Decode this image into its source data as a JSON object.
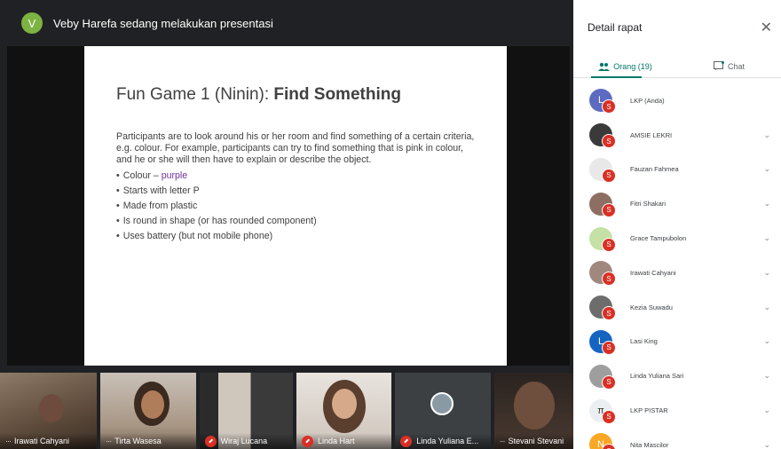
{
  "presenter": {
    "avatar_letter": "V",
    "text": "Veby Harefa sedang melakukan presentasi"
  },
  "slide": {
    "title_plain": "Fun Game 1 (Ninin): ",
    "title_bold": "Find Something",
    "body": "Participants are to look around his or her room and find something of a certain criteria, e.g. colour. For example, participants can try to find something that is pink in colour, and he or she will then have to explain or describe the object.",
    "bullet_1_prefix": "Colour – ",
    "bullet_1_colored": "purple",
    "bullets": [
      "Starts with letter P",
      "Made from plastic",
      "Is round in shape (or has rounded component)",
      "Uses battery (but not mobile phone)"
    ],
    "bullet_glyph": "•"
  },
  "thumbnails": [
    {
      "label": "Irawati Cahyani",
      "status": "more"
    },
    {
      "label": "Tirta Wasesa",
      "status": "more"
    },
    {
      "label": "Wiraj Lucana",
      "status": "muted"
    },
    {
      "label": "Linda Hart",
      "status": "muted"
    },
    {
      "label": "Linda Yuliana E...",
      "status": "muted"
    },
    {
      "label": "Stevani Stevani",
      "status": "more"
    }
  ],
  "panel": {
    "title": "Detail rapat",
    "close_glyph": "✕",
    "tabs": {
      "people": "Orang (19)",
      "chat": "Chat"
    },
    "mute_badge": "S",
    "chevron": "⌄",
    "people": [
      {
        "name": "LKP (Anda)",
        "avatar_color": "#5c6bc0",
        "letter": "L"
      },
      {
        "name": "AMSIE LEKRI",
        "avatar_color": "#3a3a3a",
        "letter": ""
      },
      {
        "name": "Fauzan Fahmea",
        "avatar_color": "#e8e8e8",
        "letter": ""
      },
      {
        "name": "Fitri Shakari",
        "avatar_color": "#8d6e63",
        "letter": ""
      },
      {
        "name": "Grace Tampubolon",
        "avatar_color": "#c5e1a5",
        "letter": ""
      },
      {
        "name": "Irawati Cahyani",
        "avatar_color": "#a1887f",
        "letter": ""
      },
      {
        "name": "Kezia Suwadu",
        "avatar_color": "#6d6d6d",
        "letter": ""
      },
      {
        "name": "Lasi King",
        "avatar_color": "#1565c0",
        "letter": "L"
      },
      {
        "name": "Linda Yuliana Sari",
        "avatar_color": "#9e9e9e",
        "letter": ""
      },
      {
        "name": "LKP PISTAR",
        "avatar_color": "#eceff1",
        "letter": "π"
      },
      {
        "name": "Nita Mascilor",
        "avatar_color": "#f9a825",
        "letter": "N"
      }
    ]
  }
}
